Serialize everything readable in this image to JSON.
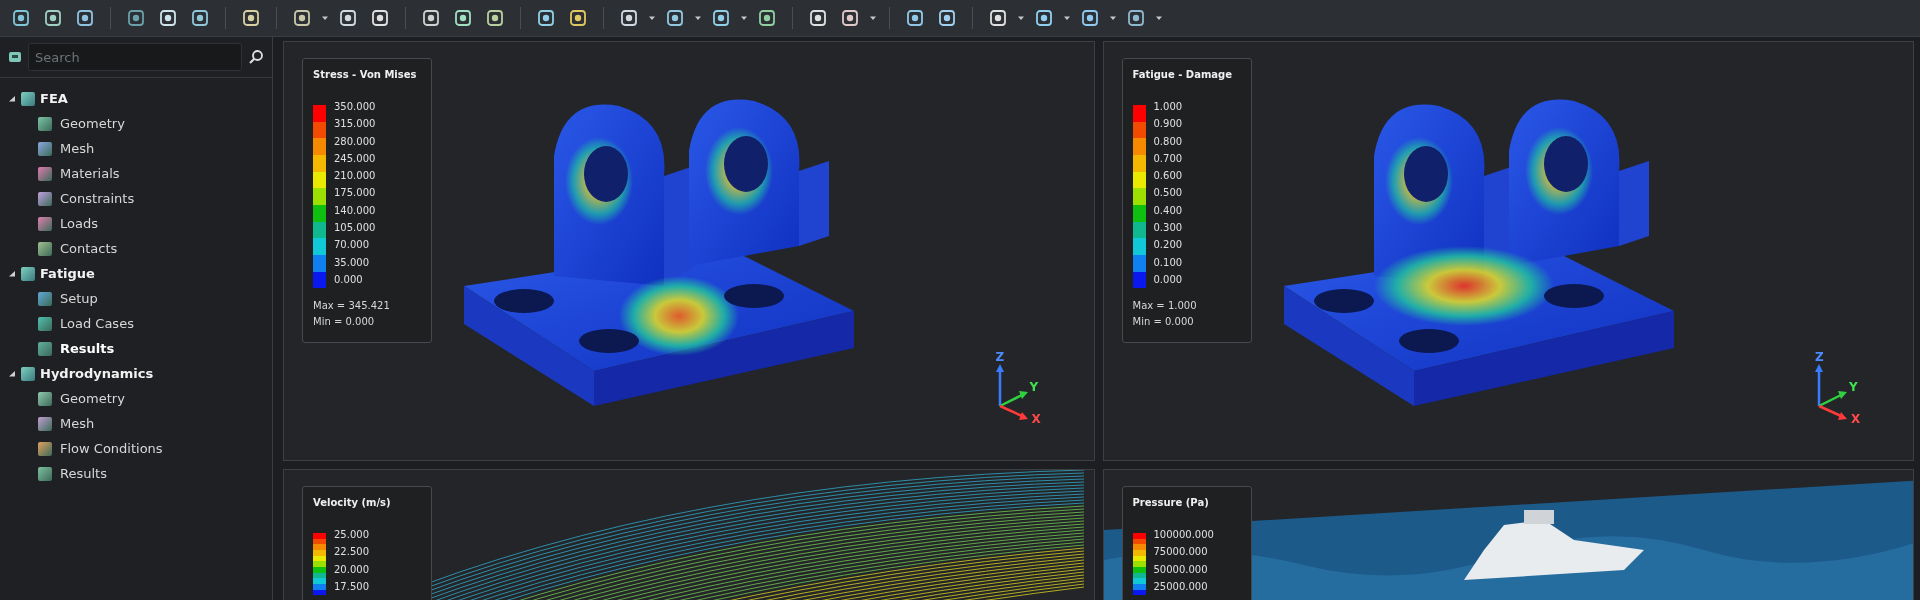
{
  "sidebar": {
    "search": {
      "placeholder": "Search"
    },
    "tree": [
      {
        "label": "FEA",
        "expanded": true,
        "children": [
          {
            "label": "Geometry",
            "selected": false
          },
          {
            "label": "Mesh",
            "selected": false
          },
          {
            "label": "Materials",
            "selected": false
          },
          {
            "label": "Constraints",
            "selected": false
          },
          {
            "label": "Loads",
            "selected": false
          },
          {
            "label": "Contacts",
            "selected": false
          }
        ]
      },
      {
        "label": "Fatigue",
        "expanded": true,
        "children": [
          {
            "label": "Setup",
            "selected": false
          },
          {
            "label": "Load Cases",
            "selected": false
          },
          {
            "label": "Results",
            "selected": true
          }
        ]
      },
      {
        "label": "Hydrodynamics",
        "expanded": true,
        "children": [
          {
            "label": "Geometry",
            "selected": false
          },
          {
            "label": "Mesh",
            "selected": false
          },
          {
            "label": "Flow Conditions",
            "selected": false
          },
          {
            "label": "Results",
            "selected": false
          }
        ]
      }
    ]
  },
  "viewports": [
    {
      "kind": "bracket",
      "legend": {
        "title": "Stress - Von Mises",
        "values": [
          "350.000",
          "315.000",
          "280.000",
          "245.000",
          "210.000",
          "175.000",
          "140.000",
          "105.000",
          "70.000",
          "35.000",
          "0.000"
        ],
        "max": "Max = 345.421",
        "min": "Min = 0.000"
      },
      "axes": {
        "x": "X",
        "y": "Y",
        "z": "Z"
      }
    },
    {
      "kind": "bracket-fatigue",
      "legend": {
        "title": "Fatigue - Damage",
        "values": [
          "1.000",
          "0.900",
          "0.800",
          "0.700",
          "0.600",
          "0.500",
          "0.400",
          "0.300",
          "0.200",
          "0.100",
          "0.000"
        ],
        "max": "Max = 1.000",
        "min": "Min = 0.000"
      },
      "axes": {
        "x": "X",
        "y": "Y",
        "z": "Z"
      }
    },
    {
      "kind": "streamlines",
      "legend": {
        "title": "Velocity (m/s)",
        "values": [
          "25.000",
          "22.500",
          "20.000",
          "17.500"
        ]
      }
    },
    {
      "kind": "boat",
      "legend": {
        "title": "Pressure (Pa)",
        "values": [
          "100000.000",
          "75000.000",
          "50000.000",
          "25000.000"
        ]
      }
    }
  ]
}
